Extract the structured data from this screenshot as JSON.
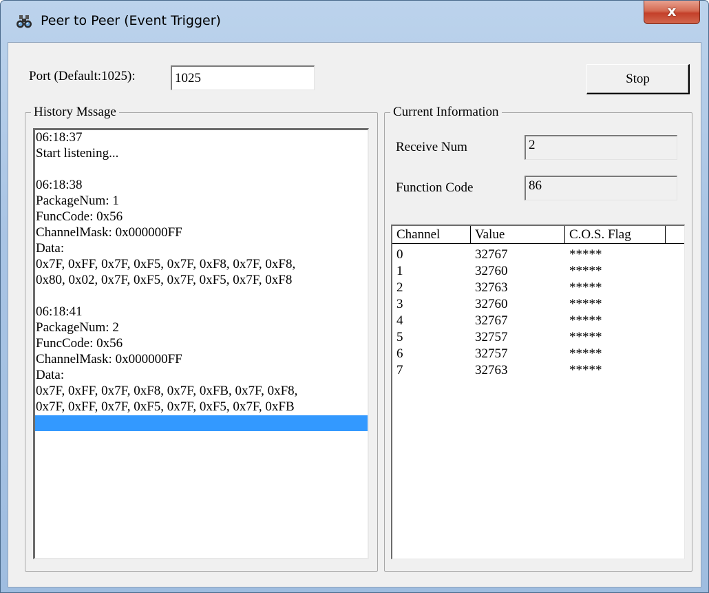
{
  "window": {
    "title": "Peer to Peer (Event Trigger)",
    "close_label": "x",
    "icon": "binoculars-icon"
  },
  "port": {
    "label": "Port (Default:1025):",
    "value": "1025"
  },
  "stop_button": {
    "label": "Stop"
  },
  "history": {
    "title": "History Mssage",
    "lines": [
      "06:18:37",
      "Start listening...",
      "",
      "06:18:38",
      "PackageNum: 1",
      "FuncCode: 0x56",
      "ChannelMask: 0x000000FF",
      "Data:",
      "0x7F, 0xFF, 0x7F, 0xF5, 0x7F, 0xF8, 0x7F, 0xF8,",
      "0x80, 0x02, 0x7F, 0xF5, 0x7F, 0xF5, 0x7F, 0xF8",
      "",
      "06:18:41",
      "PackageNum: 2",
      "FuncCode: 0x56",
      "ChannelMask: 0x000000FF",
      "Data:",
      "0x7F, 0xFF, 0x7F, 0xF8, 0x7F, 0xFB, 0x7F, 0xF8,",
      "0x7F, 0xFF, 0x7F, 0xF5, 0x7F, 0xF5, 0x7F, 0xFB",
      ""
    ],
    "selected_index": 18
  },
  "current_info": {
    "title": "Current Information",
    "receive_num": {
      "label": "Receive Num",
      "value": "2"
    },
    "function_code": {
      "label": "Function Code",
      "value": "86"
    }
  },
  "channel_table": {
    "columns": [
      "Channel",
      "Value",
      "C.O.S. Flag"
    ],
    "rows": [
      [
        "0",
        "32767",
        "*****"
      ],
      [
        "1",
        "32760",
        "*****"
      ],
      [
        "2",
        "32763",
        "*****"
      ],
      [
        "3",
        "32760",
        "*****"
      ],
      [
        "4",
        "32767",
        "*****"
      ],
      [
        "5",
        "32757",
        "*****"
      ],
      [
        "6",
        "32757",
        "*****"
      ],
      [
        "7",
        "32763",
        "*****"
      ]
    ]
  },
  "colors": {
    "selection": "#3399ff",
    "close_button": "#c4402a",
    "dialog_face": "#f0f0f0"
  }
}
